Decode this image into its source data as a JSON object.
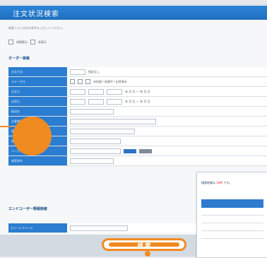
{
  "header": {
    "title": "注文状況検索"
  },
  "subtitle": "検索したい注文の条件を入力してください。",
  "options": {
    "checkbox1_label": "初期表示",
    "checkbox2_label": "非表示"
  },
  "sections": {
    "order_info_title": "オーダー検索",
    "extra_info_title": "エンドユーザー情報検索"
  },
  "table": {
    "rows": [
      {
        "label": "注文方法",
        "value": "指定なし"
      },
      {
        "label": "ステータス",
        "value": "未処理 / 処理中 / 出荷済み"
      },
      {
        "label": "注文日",
        "value": "年 月 日 〜 年 月 日"
      },
      {
        "label": "出荷日",
        "value": "年 月 日 〜 年 月 日"
      },
      {
        "label": "配送先",
        "value": ""
      },
      {
        "label": "お客様名",
        "value": ""
      },
      {
        "label": "電話番号",
        "value": ""
      },
      {
        "label": "商品コード",
        "value": ""
      },
      {
        "label": "メーカー",
        "value": ""
      },
      {
        "label": "検索条件",
        "value": ""
      }
    ]
  },
  "footer": {
    "field_label": "Eメールアドレス",
    "search_button": "検 索"
  },
  "popup": {
    "title_prefix": "検索結果は",
    "title_count": "10件",
    "title_suffix": "です。"
  },
  "colors": {
    "header": "#1f6fbf",
    "accent": "#f08b22",
    "label_bg": "#2a7dd0"
  }
}
